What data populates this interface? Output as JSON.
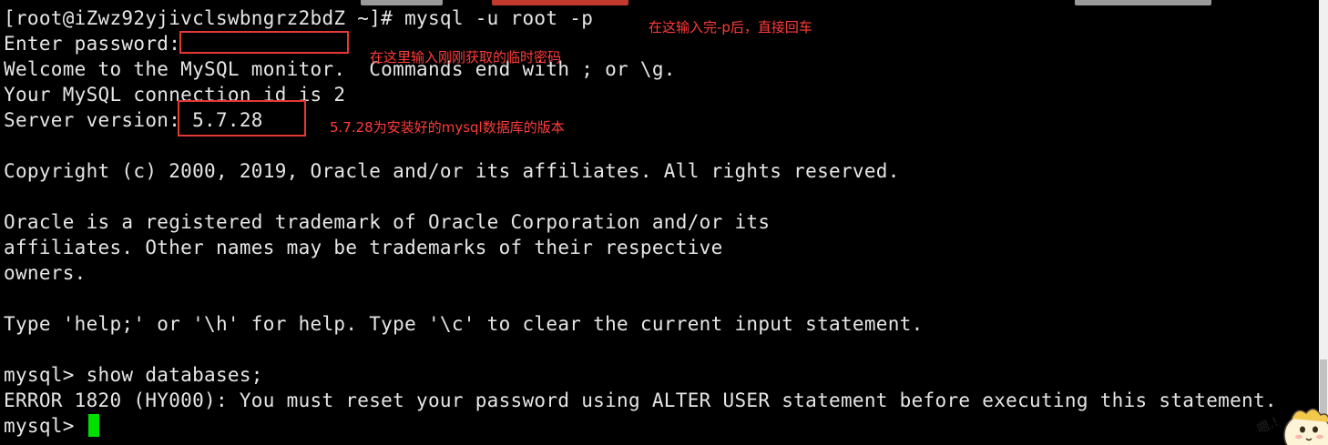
{
  "terminal": {
    "lines": [
      "[root@iZwz92yjivclswbngrz2bdZ ~]# mysql -u root -p",
      "Enter password:",
      "Welcome to the MySQL monitor.  Commands end with ; or \\g.",
      "Your MySQL connection id is 2",
      "Server version: 5.7.28",
      "",
      "Copyright (c) 2000, 2019, Oracle and/or its affiliates. All rights reserved.",
      "",
      "Oracle is a registered trademark of Oracle Corporation and/or its",
      "affiliates. Other names may be trademarks of their respective",
      "owners.",
      "",
      "Type 'help;' or '\\h' for help. Type '\\c' to clear the current input statement.",
      "",
      "mysql> show databases;",
      "ERROR 1820 (HY000): You must reset your password using ALTER USER statement before executing this statement.",
      "mysql> "
    ],
    "cursor_color": "#00e000",
    "text_color": "#e6e6e6",
    "background": "#000000"
  },
  "annotations": {
    "after_p": "在这输入完-p后，直接回车",
    "password_hint": "在这里输入刚刚获取的临时密码",
    "version_hint": "5.7.28为安装好的mysql数据库的版本",
    "color": "#ff3b3b"
  },
  "sticker": {
    "icon": "cartoon-sticker-icon",
    "text": "嗯.!"
  }
}
